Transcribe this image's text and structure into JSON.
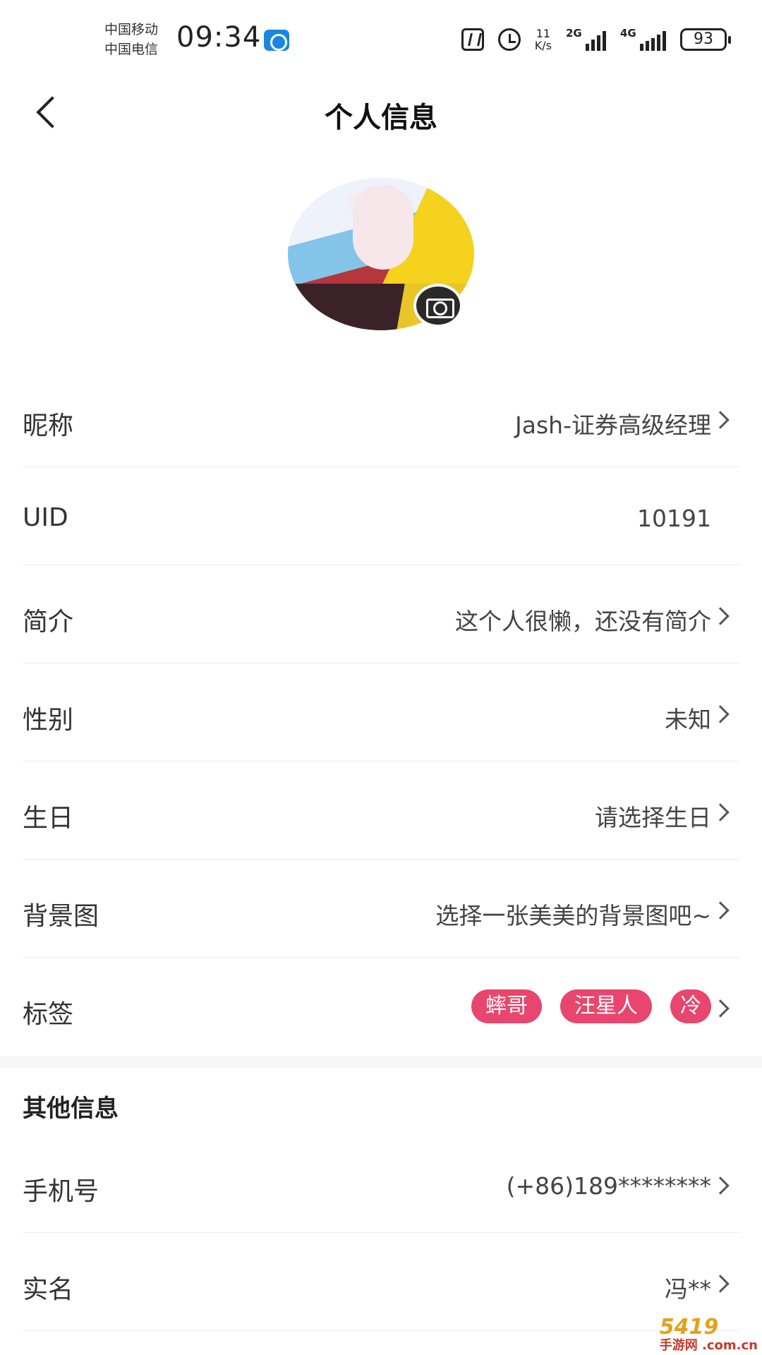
{
  "status_bar": {
    "carrier1": "中国移动",
    "carrier2": "中国电信",
    "time": "09:34",
    "speed_value": "11",
    "speed_unit": "K/s",
    "sig1_tag": "2G",
    "sig2_tag": "4G",
    "battery": "93"
  },
  "header": {
    "title": "个人信息"
  },
  "rows": {
    "nickname": {
      "label": "昵称",
      "value": "Jash-证券高级经理"
    },
    "uid": {
      "label": "UID",
      "value": "10191"
    },
    "bio": {
      "label": "简介",
      "value": "这个人很懒，还没有简介"
    },
    "gender": {
      "label": "性别",
      "value": "未知"
    },
    "birthday": {
      "label": "生日",
      "value": "请选择生日"
    },
    "background": {
      "label": "背景图",
      "value": "选择一张美美的背景图吧~"
    },
    "tags": {
      "label": "标签",
      "items": [
        "蟀哥",
        "汪星人",
        "冷"
      ]
    }
  },
  "other": {
    "section_title": "其他信息",
    "phone": {
      "label": "手机号",
      "value": "(+86)189********"
    },
    "realname": {
      "label": "实名",
      "value": "冯**"
    }
  },
  "watermark": {
    "main": "5419",
    "sub": "手游网 .com.cn"
  },
  "colors": {
    "tag_bg": "#e8466e",
    "divider": "#ececec"
  }
}
